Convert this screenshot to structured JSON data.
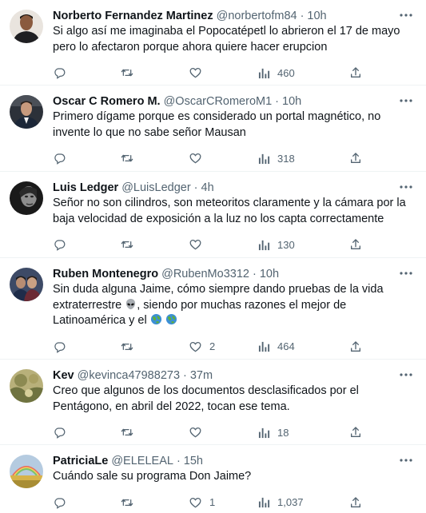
{
  "tweets": [
    {
      "name": "Norberto Fernandez Martinez",
      "handle": "@norbertofm84",
      "separator": "·",
      "time": "10h",
      "text_parts": [
        "Si algo así me imaginaba el Popocatépetl lo abrieron el 17 de mayo pero lo afectaron porque ahora quiere hacer erupcion"
      ],
      "likes": "",
      "views": "460"
    },
    {
      "name": "Oscar C Romero M.",
      "handle": "@OscarCRomeroM1",
      "separator": "·",
      "time": "10h",
      "text_parts": [
        "Primero dígame porque es considerado un portal magnético, no invente lo que no sabe señor Mausan"
      ],
      "likes": "",
      "views": "318"
    },
    {
      "name": "Luis Ledger",
      "handle": "@LuisLedger",
      "separator": "·",
      "time": "4h",
      "text_parts": [
        "Señor no son cilindros, son meteoritos claramente y la cámara por la baja velocidad de exposición a la luz no los capta correctamente"
      ],
      "likes": "",
      "views": "130"
    },
    {
      "name": "Ruben Montenegro",
      "handle": "@RubenMo3312",
      "separator": "·",
      "time": "10h",
      "text_parts": [
        "Sin duda alguna Jaime, cómo siempre dando pruebas de la vida extraterrestre ",
        ", siendo por muchas razones el mejor de Latinoamérica y el "
      ],
      "emojis": [
        "alien-emoji",
        "earth-emoji",
        "earth-emoji"
      ],
      "likes": "2",
      "views": "464"
    },
    {
      "name": "Kev",
      "handle": "@kevinca47988273",
      "separator": "·",
      "time": "37m",
      "text_parts": [
        "Creo que algunos de los documentos desclasificados por el Pentágono, en abril del 2022, tocan ese tema."
      ],
      "likes": "",
      "views": "18"
    },
    {
      "name": "PatriciaLe",
      "handle": "@ELELEAL",
      "separator": "·",
      "time": "15h",
      "text_parts": [
        "Cuándo sale su programa Don Jaime?"
      ],
      "likes": "1",
      "views": "1,037"
    }
  ],
  "icons": {
    "more": "more-icon",
    "reply": "reply-icon",
    "retweet": "retweet-icon",
    "like": "like-icon",
    "views": "views-icon",
    "share": "share-icon"
  },
  "colors": {
    "text": "#0f1419",
    "secondary": "#536471",
    "divider": "#eff3f4"
  }
}
